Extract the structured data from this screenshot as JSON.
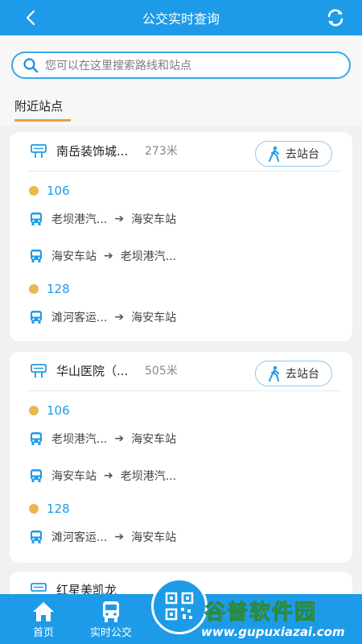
{
  "header": {
    "title": "公交实时查询"
  },
  "search": {
    "placeholder": "您可以在这里搜索路线和站点"
  },
  "section": {
    "label": "附近站点"
  },
  "cards": [
    {
      "stop_name": "南岳装饰城...",
      "distance": "273米",
      "go_label": "去站台",
      "routes": [
        {
          "number": "106",
          "directions": [
            {
              "from": "老坝港汽...",
              "to": "海安车站"
            },
            {
              "from": "海安车站",
              "to": "老坝港汽..."
            }
          ]
        },
        {
          "number": "128",
          "directions": [
            {
              "from": "滩河客运...",
              "to": "海安车站"
            }
          ]
        }
      ]
    },
    {
      "stop_name": "华山医院（...",
      "distance": "505米",
      "go_label": "去站台",
      "routes": [
        {
          "number": "106",
          "directions": [
            {
              "from": "老坝港汽...",
              "to": "海安车站"
            },
            {
              "from": "海安车站",
              "to": "老坝港汽..."
            }
          ]
        },
        {
          "number": "128",
          "directions": [
            {
              "from": "滩河客运...",
              "to": "海安车站"
            }
          ]
        }
      ]
    }
  ],
  "partial_card": {
    "stop_name": "红星美凯龙"
  },
  "tabs": [
    {
      "label": "首页"
    },
    {
      "label": "实时公交"
    }
  ],
  "watermark": {
    "top": "谷普软件园",
    "bottom": "www.gupuxiazai.com"
  },
  "colors": {
    "primary": "#1e9be8",
    "dot": "#eab84d",
    "underline": "#e9a13a"
  },
  "icons": {
    "back": "chevron-left-icon",
    "refresh": "refresh-icon",
    "search": "search-icon",
    "stop": "bus-stop-icon",
    "walk": "walk-icon",
    "bus": "bus-icon",
    "home": "home-icon",
    "qr": "qr-code-icon"
  }
}
